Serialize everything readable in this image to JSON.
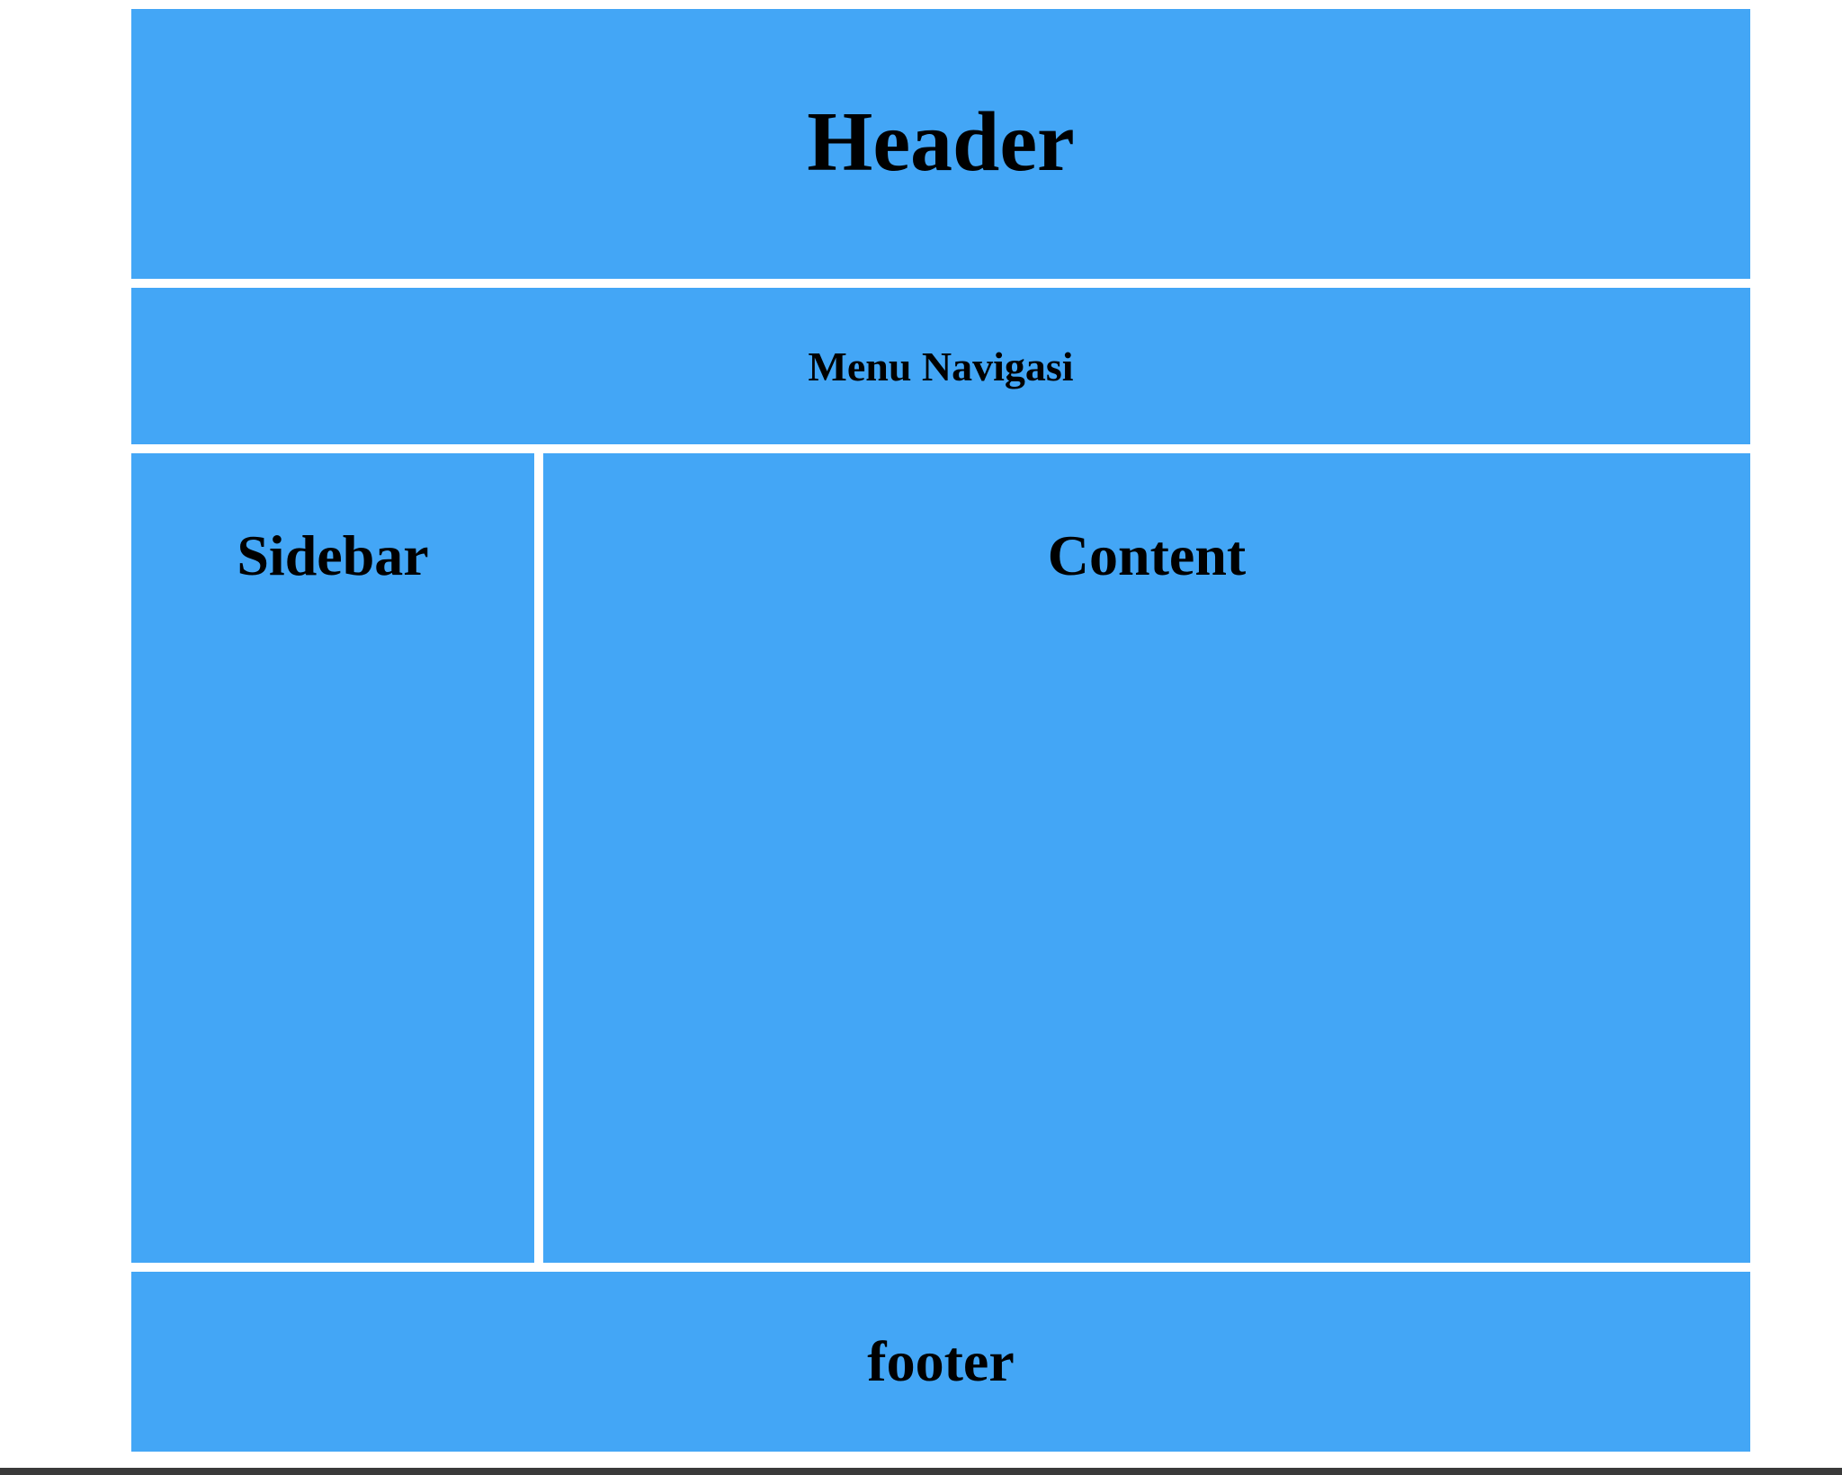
{
  "colors": {
    "block_bg": "#43a6f6",
    "page_bg": "#ffffff",
    "text": "#000000",
    "bottom_bar": "#3a3a3a"
  },
  "header": {
    "title": "Header"
  },
  "nav": {
    "label": "Menu Navigasi"
  },
  "sidebar": {
    "title": "Sidebar"
  },
  "content": {
    "title": "Content"
  },
  "footer": {
    "title": "footer"
  }
}
